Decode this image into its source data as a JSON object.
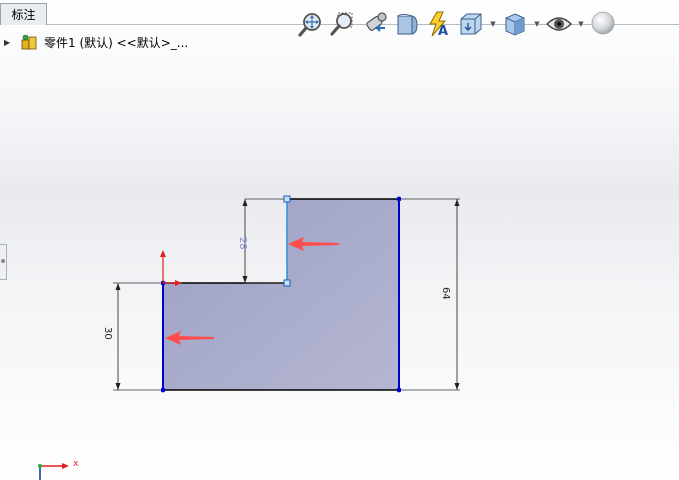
{
  "tab": {
    "label": "标注"
  },
  "tree": {
    "label": "零件1 (默认) <<默认>_..."
  },
  "toolbar": {
    "items": [
      {
        "name": "zoom-to-fit",
        "icon": "zoom-fit-icon"
      },
      {
        "name": "zoom-to-area",
        "icon": "zoom-area-icon"
      },
      {
        "name": "previous-view",
        "icon": "previous-view-icon"
      },
      {
        "name": "section-view",
        "icon": "section-view-icon"
      },
      {
        "name": "dynamic-annotation-views",
        "icon": "annotation-view-icon"
      },
      {
        "name": "view-orientation",
        "icon": "view-orientation-icon",
        "dropdown": true
      },
      {
        "name": "display-style",
        "icon": "display-style-icon",
        "dropdown": true
      },
      {
        "name": "hide-show-items",
        "icon": "eye-icon",
        "dropdown": true
      },
      {
        "name": "edit-appearance",
        "icon": "appearance-sphere-icon"
      }
    ]
  },
  "sketch": {
    "dimensions": {
      "height_small": "28",
      "height_left": "30",
      "height_total": "64"
    },
    "fill_color": "#a5a7c8",
    "line_color": "#0000cc",
    "arrow_color": "#ff4d4d"
  },
  "triad": {
    "x_label": "x"
  }
}
